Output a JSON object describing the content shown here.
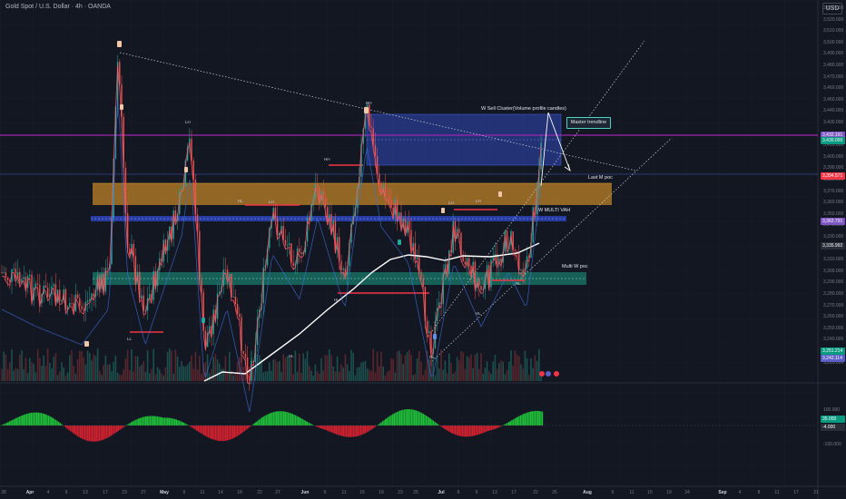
{
  "header": {
    "symbol_title": "Gold Spot / U.S. Dollar · 4h · OANDA",
    "currency": "USD"
  },
  "price_axis": [
    "3,530.000",
    "3,520.000",
    "3,510.000",
    "3,500.000",
    "3,490.000",
    "3,480.000",
    "3,470.000",
    "3,460.000",
    "3,450.000",
    "3,440.000",
    "3,430.000",
    "3,420.000",
    "3,410.000",
    "3,400.000",
    "3,390.000",
    "3,380.000",
    "3,370.000",
    "3,360.000",
    "3,350.000",
    "3,340.000",
    "3,330.000",
    "3,320.000",
    "3,310.000",
    "3,300.000",
    "3,290.000",
    "3,280.000",
    "3,270.000",
    "3,260.000",
    "3,250.000",
    "3,240.000",
    "3,230.000",
    "3,220.000"
  ],
  "price_tags": [
    {
      "text": "3,432.191",
      "color": "#7e57c2"
    },
    {
      "text": "3,430.000",
      "color": "#089981"
    },
    {
      "text": "3,394.571",
      "color": "#f23645"
    },
    {
      "text": "3,362.791",
      "color": "#7e57c2"
    },
    {
      "text": "3,335.992",
      "color": "#2a2e39"
    },
    {
      "text": "3,251.214",
      "color": "#089981"
    },
    {
      "text": "3,242.114",
      "color": "#5b5fc7"
    }
  ],
  "osc_axis": [
    "100.000",
    "-100.000"
  ],
  "osc_tags": [
    {
      "text": "35.000",
      "color": "#089981"
    },
    {
      "text": "-4.000",
      "color": "#2a2e39"
    }
  ],
  "dates": [
    {
      "t": "28",
      "month": false
    },
    {
      "t": "Apr",
      "month": true
    },
    {
      "t": "4",
      "month": false
    },
    {
      "t": "9",
      "month": false
    },
    {
      "t": "13",
      "month": false
    },
    {
      "t": "17",
      "month": false
    },
    {
      "t": "23",
      "month": false
    },
    {
      "t": "27",
      "month": false
    },
    {
      "t": "May",
      "month": true
    },
    {
      "t": "6",
      "month": false
    },
    {
      "t": "11",
      "month": false
    },
    {
      "t": "14",
      "month": false
    },
    {
      "t": "18",
      "month": false
    },
    {
      "t": "22",
      "month": false
    },
    {
      "t": "27",
      "month": false
    },
    {
      "t": "Jun",
      "month": true
    },
    {
      "t": "6",
      "month": false
    },
    {
      "t": "11",
      "month": false
    },
    {
      "t": "15",
      "month": false
    },
    {
      "t": "19",
      "month": false
    },
    {
      "t": "23",
      "month": false
    },
    {
      "t": "25",
      "month": false
    },
    {
      "t": "Jul",
      "month": true
    },
    {
      "t": "6",
      "month": false
    },
    {
      "t": "9",
      "month": false
    },
    {
      "t": "13",
      "month": false
    },
    {
      "t": "17",
      "month": false
    },
    {
      "t": "22",
      "month": false
    },
    {
      "t": "25",
      "month": false
    },
    {
      "t": "Aug",
      "month": true
    },
    {
      "t": "6",
      "month": false
    },
    {
      "t": "11",
      "month": false
    },
    {
      "t": "15",
      "month": false
    },
    {
      "t": "19",
      "month": false
    },
    {
      "t": "24",
      "month": false
    },
    {
      "t": "Sep",
      "month": true
    },
    {
      "t": "4",
      "month": false
    },
    {
      "t": "8",
      "month": false
    },
    {
      "t": "11",
      "month": false
    },
    {
      "t": "17",
      "month": false
    },
    {
      "t": "21",
      "month": false
    }
  ],
  "annotations": {
    "sell_cluster": "W Sell Cluster(Volume profile candles)",
    "master_trendline": "Master trendline",
    "last_m_poc": "Last M poc",
    "w_multi_vah": "W MULTI VAH",
    "multi_w_poc": "Multi W poc"
  },
  "swing_labels": [
    "LH",
    "HH",
    "HH",
    "LH",
    "LH",
    "LL",
    "HL",
    "HL",
    "HL",
    "HL",
    "HL",
    "HL",
    "LH"
  ],
  "colors": {
    "background": "#131722",
    "sell_zone": "#2f49b8",
    "poc_zone": "#c98a26",
    "vah_zone": "#2d46c2",
    "wpoc_zone": "#1a7a6a",
    "ema": "#ffffff",
    "purple_line": "#9c27b0",
    "bull": "#26a69a",
    "bear": "#ef5350"
  }
}
